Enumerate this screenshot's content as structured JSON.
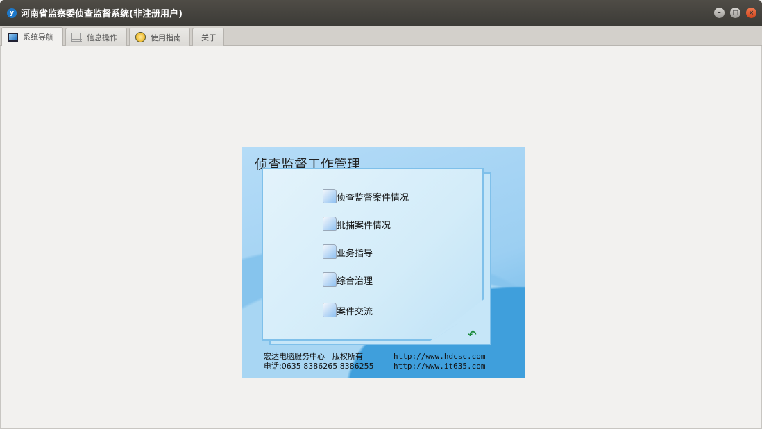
{
  "window": {
    "title": "河南省监察委侦查监督系统(非注册用户)",
    "icon": "app-logo-icon"
  },
  "tabs": [
    {
      "label": "系统导航",
      "icon": "monitor-icon",
      "active": true
    },
    {
      "label": "信息操作",
      "icon": "grid-icon"
    },
    {
      "label": "使用指南",
      "icon": "help-icon"
    },
    {
      "label": "关于"
    }
  ],
  "panel": {
    "title": "侦查监督工作管理",
    "items": [
      {
        "label": "侦查监督案件情况"
      },
      {
        "label": "批捕案件情况"
      },
      {
        "label": "业务指导"
      },
      {
        "label": "综合治理"
      },
      {
        "label": "案件交流"
      }
    ],
    "footer": {
      "company": "宏达电脑服务中心　版权所有",
      "phone": "电话:0635 8386265 8386255",
      "url1": "http://www.hdcsc.com",
      "url2": "http://www.it635.com"
    }
  }
}
